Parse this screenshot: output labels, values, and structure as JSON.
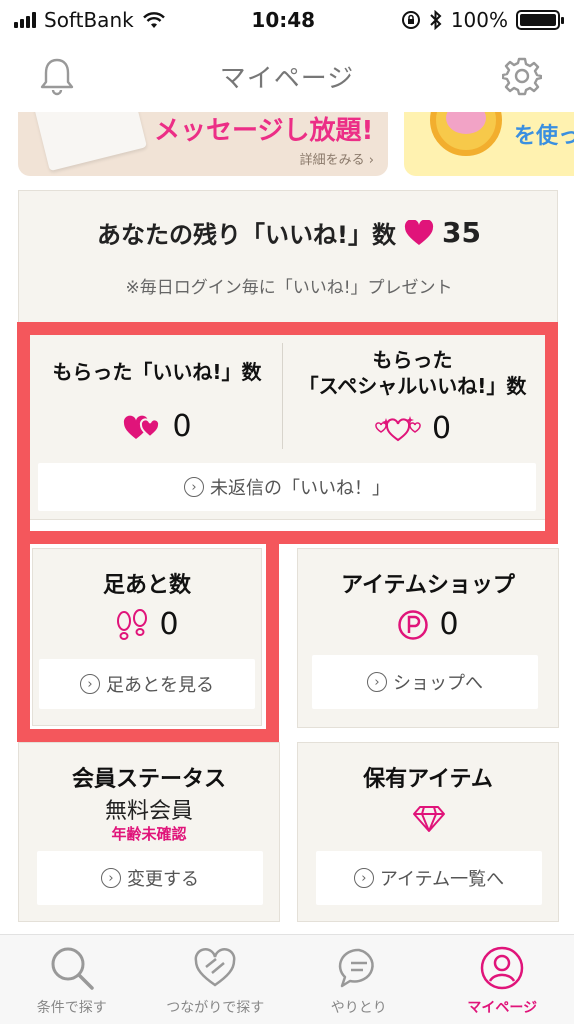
{
  "status_bar": {
    "carrier": "SoftBank",
    "time": "10:48",
    "battery": "100%"
  },
  "header": {
    "title": "マイページ"
  },
  "banners": {
    "message_title": "メッセージし放題!",
    "detail_link": "詳細をみる ›",
    "use_text": "を使っ"
  },
  "remaining_likes": {
    "label": "あなたの残り「いいね!」数",
    "count": "35",
    "note": "※毎日ログイン毎に「いいね!」プレゼント"
  },
  "received": {
    "likes_label": "もらった「いいね!」数",
    "likes_count": "0",
    "special_label_line1": "もらった",
    "special_label_line2": "「スペシャルいいね!」数",
    "special_count": "0",
    "unreplied_button": "未返信の「いいね！」"
  },
  "footprints": {
    "title": "足あと数",
    "count": "0",
    "button": "足あとを見る"
  },
  "item_shop": {
    "title": "アイテムショップ",
    "count": "0",
    "button": "ショップへ"
  },
  "member_status": {
    "title": "会員ステータス",
    "status": "無料会員",
    "age_note": "年齢未確認",
    "button": "変更する"
  },
  "owned_items": {
    "title": "保有アイテム",
    "button": "アイテム一覧へ"
  },
  "tabs": [
    {
      "label": "条件で探す",
      "icon": "search-icon"
    },
    {
      "label": "つながりで探す",
      "icon": "heart-link-icon"
    },
    {
      "label": "やりとり",
      "icon": "chat-icon"
    },
    {
      "label": "マイページ",
      "icon": "profile-icon"
    }
  ],
  "colors": {
    "accent_pink": "#e0147a",
    "highlight_red": "#f4575c",
    "panel_bg": "#f6f4ef"
  }
}
